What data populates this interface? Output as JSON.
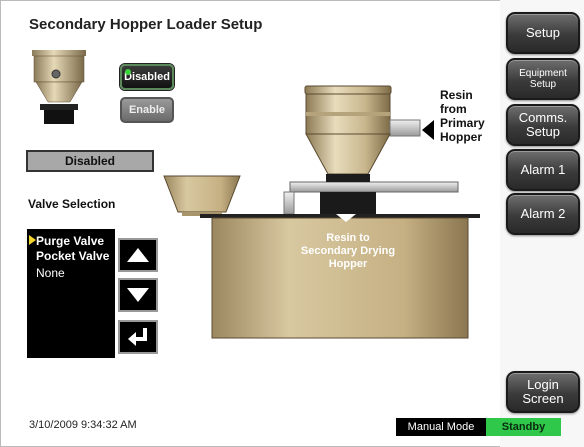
{
  "header": {
    "title": "Secondary Hopper Loader Setup"
  },
  "loader_controls": {
    "disabled_label": "Disabled",
    "enable_label": "Enable",
    "status_text": "Disabled"
  },
  "valve_selection": {
    "label": "Valve Selection",
    "items": [
      "Purge Valve",
      "Pocket Valve",
      "None"
    ],
    "selected_index": 0
  },
  "sidebar": {
    "setup": "Setup",
    "equipment_setup_line1": "Equipment",
    "equipment_setup_line2": "Setup",
    "comms_setup_line1": "Comms.",
    "comms_setup_line2": "Setup",
    "alarm1": "Alarm 1",
    "alarm2": "Alarm 2",
    "login_line1": "Login",
    "login_line2": "Screen"
  },
  "diagram": {
    "resin_from_line1": "Resin",
    "resin_from_line2": "from",
    "resin_from_line3": "Primary",
    "resin_from_line4": "Hopper",
    "resin_to_line1": "Resin to",
    "resin_to_line2": "Secondary Drying",
    "resin_to_line3": "Hopper"
  },
  "status_bar": {
    "timestamp": "3/10/2009 9:34:32 AM",
    "mode": "Manual Mode",
    "state": "Standby",
    "state_color": "#2fc84a"
  }
}
